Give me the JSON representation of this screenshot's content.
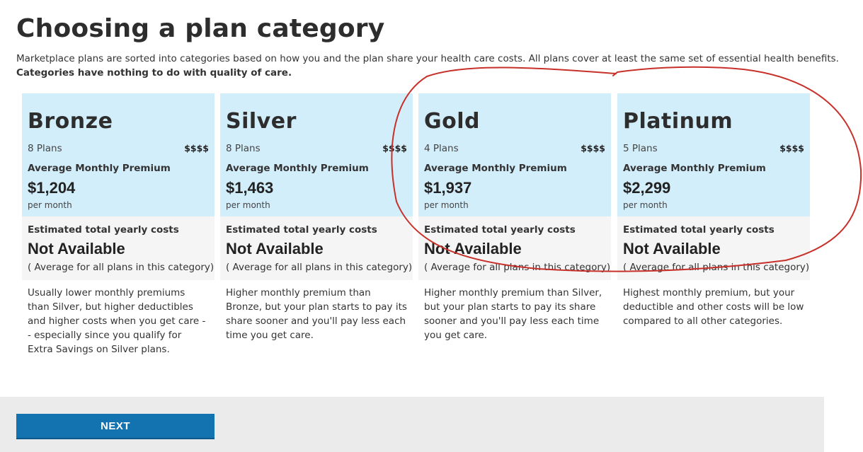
{
  "header": {
    "title": "Choosing a plan category",
    "intro": "Marketplace plans are sorted into categories based on how you and the plan share your health care costs. All plans cover at least the same set of essential health benefits.",
    "intro_strong": "Categories have nothing to do with quality of care."
  },
  "cards": [
    {
      "name": "Bronze",
      "plans": "8 Plans",
      "scale": "$$$$",
      "premium_label": "Average Monthly Premium",
      "premium": "$1,204",
      "per_month": "per month",
      "yearly_label": "Estimated total yearly costs",
      "yearly_value": "Not Available",
      "yearly_note": "( Average for all plans in this category)",
      "description": "Usually lower monthly premiums than Silver, but higher deductibles and higher costs when you get care -- especially since you qualify for Extra Savings on Silver plans."
    },
    {
      "name": "Silver",
      "plans": "8 Plans",
      "scale": "$$$$",
      "premium_label": "Average Monthly Premium",
      "premium": "$1,463",
      "per_month": "per month",
      "yearly_label": "Estimated total yearly costs",
      "yearly_value": "Not Available",
      "yearly_note": "( Average for all plans in this category)",
      "description": "Higher monthly premium than Bronze, but your plan starts to pay its share sooner and you'll pay less each time you get care."
    },
    {
      "name": "Gold",
      "plans": "4 Plans",
      "scale": "$$$$",
      "premium_label": "Average Monthly Premium",
      "premium": "$1,937",
      "per_month": "per month",
      "yearly_label": "Estimated total yearly costs",
      "yearly_value": "Not Available",
      "yearly_note": "( Average for all plans in this category)",
      "description": "Higher monthly premium than Silver, but your plan starts to pay its share sooner and you'll pay less each time you get care."
    },
    {
      "name": "Platinum",
      "plans": "5 Plans",
      "scale": "$$$$",
      "premium_label": "Average Monthly Premium",
      "premium": "$2,299",
      "per_month": "per month",
      "yearly_label": "Estimated total yearly costs",
      "yearly_value": "Not Available",
      "yearly_note": "( Average for all plans in this category)",
      "description": "Highest monthly premium, but your deductible and other costs will be low compared to all other categories."
    }
  ],
  "footer": {
    "next_label": "NEXT"
  },
  "colors": {
    "card_top_bg": "#d3eefb",
    "card_mid_bg": "#f5f5f5",
    "button_bg": "#1273b0",
    "annotation_stroke": "#c8302a"
  }
}
